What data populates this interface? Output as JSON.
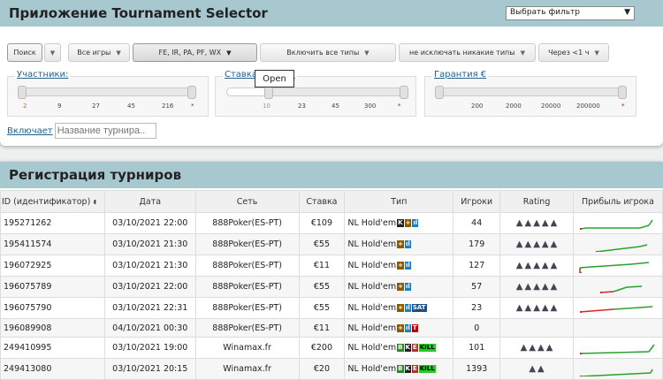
{
  "app": {
    "title": "Приложение Tournament Selector",
    "filter_select": "Выбрать фильтр"
  },
  "toolbar": {
    "search": "Поиск",
    "games": "Все игры",
    "networks": "FE, IR, PA, PF, WX",
    "include_types": "Включить все типы",
    "exclude_types": "не исключать никакие типы",
    "time": "Через <1 ч"
  },
  "sliders": {
    "participants": {
      "label": "Участники",
      "ticks": [
        "2",
        "9",
        "27",
        "45",
        "216",
        "*"
      ]
    },
    "stake": {
      "label": "Ставка",
      "label_suffix": "€:",
      "ticks": [
        "10",
        "23",
        "45",
        "300",
        "*"
      ]
    },
    "guarantee": {
      "label": "Гарантия €",
      "ticks": [
        "200",
        "2000",
        "20000",
        "200000",
        "*"
      ]
    }
  },
  "tooltip": "Open",
  "name_filter": {
    "label": "Включает",
    "placeholder": "Название турнира.."
  },
  "registration": {
    "title": "Регистрация турниров",
    "columns": [
      "ID (идентификатор)",
      "Дата",
      "Сеть",
      "Ставка",
      "Тип",
      "Игроки",
      "Rating",
      "Прибыль игрока"
    ],
    "rows": [
      {
        "id": "195271262",
        "date": "03/10/2021 22:00",
        "network": "888Poker(ES-PT)",
        "stake": "€109",
        "type": "NL Hold'em",
        "badges": [
          "K",
          "+",
          "ıl"
        ],
        "players": "44",
        "rating": 5
      },
      {
        "id": "195411574",
        "date": "03/10/2021 21:30",
        "network": "888Poker(ES-PT)",
        "stake": "€55",
        "type": "NL Hold'em",
        "badges": [
          "+",
          "ıl"
        ],
        "players": "179",
        "rating": 5
      },
      {
        "id": "196072925",
        "date": "03/10/2021 21:30",
        "network": "888Poker(ES-PT)",
        "stake": "€11",
        "type": "NL Hold'em",
        "badges": [
          "+",
          "ıl"
        ],
        "players": "127",
        "rating": 5
      },
      {
        "id": "196075789",
        "date": "03/10/2021 22:00",
        "network": "888Poker(ES-PT)",
        "stake": "€55",
        "type": "NL Hold'em",
        "badges": [
          "+",
          "ıl"
        ],
        "players": "57",
        "rating": 5
      },
      {
        "id": "196075790",
        "date": "03/10/2021 22:31",
        "network": "888Poker(ES-PT)",
        "stake": "€55",
        "type": "NL Hold'em",
        "badges": [
          "+",
          "ıl",
          "SAT"
        ],
        "players": "23",
        "rating": 5
      },
      {
        "id": "196089908",
        "date": "04/10/2021 00:30",
        "network": "888Poker(ES-PT)",
        "stake": "€11",
        "type": "NL Hold'em",
        "badges": [
          "+",
          "ıl",
          "T"
        ],
        "players": "0",
        "rating": 0
      },
      {
        "id": "249410995",
        "date": "03/10/2021 19:00",
        "network": "Winamax.fr",
        "stake": "€200",
        "type": "NL Hold'em",
        "badges": [
          "B",
          "K",
          "E",
          "KILL"
        ],
        "players": "101",
        "rating": 4
      },
      {
        "id": "249413080",
        "date": "03/10/2021 20:15",
        "network": "Winamax.fr",
        "stake": "€20",
        "type": "NL Hold'em",
        "badges": [
          "B",
          "K",
          "E",
          "KILL"
        ],
        "players": "1393",
        "rating": 2
      }
    ]
  },
  "colors": {
    "header": "#a8c8d0",
    "link": "#1f5f8e",
    "profit": "#2ca02c",
    "loss": "#d62728"
  }
}
